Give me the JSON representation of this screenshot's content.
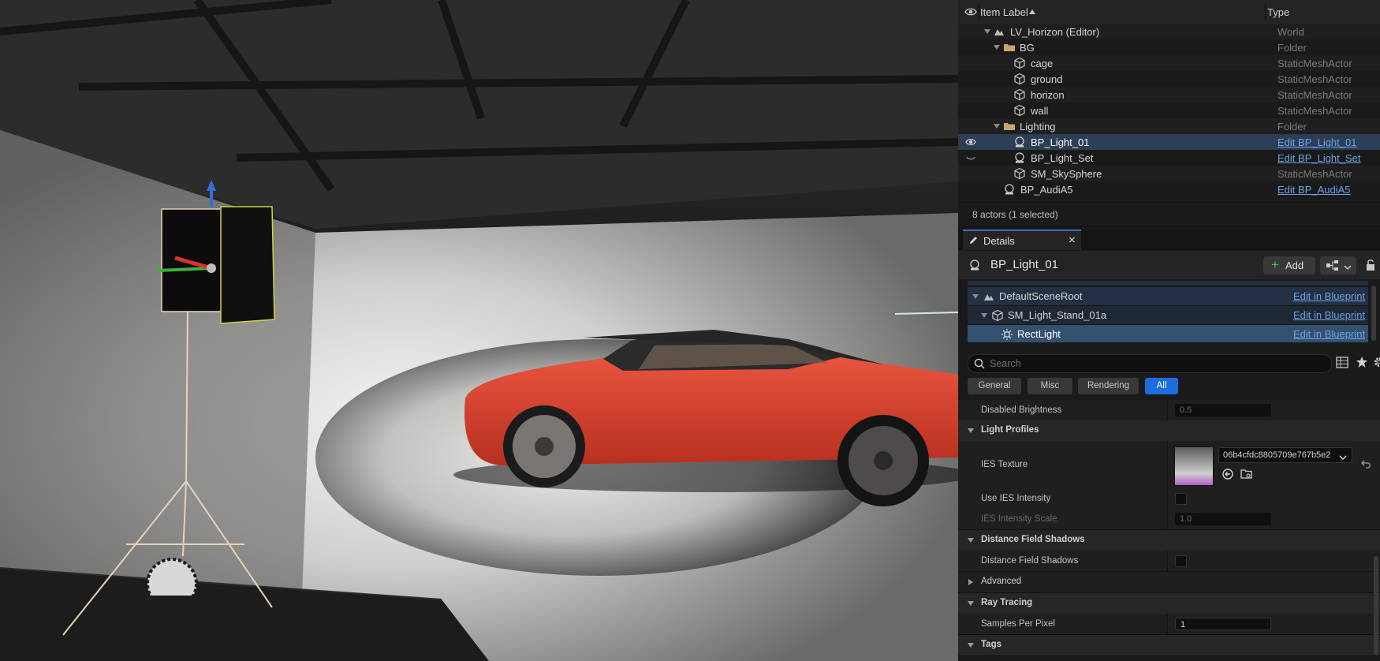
{
  "outliner": {
    "col_item_label": "Item Label",
    "col_type": "Type",
    "rows": [
      {
        "label": "LV_Horizon (Editor)",
        "type": "World"
      },
      {
        "label": "BG",
        "type": "Folder"
      },
      {
        "label": "cage",
        "type": "StaticMeshActor"
      },
      {
        "label": "ground",
        "type": "StaticMeshActor"
      },
      {
        "label": "horizon",
        "type": "StaticMeshActor"
      },
      {
        "label": "wall",
        "type": "StaticMeshActor"
      },
      {
        "label": "Lighting",
        "type": "Folder"
      },
      {
        "label": "BP_Light_01",
        "type": "Edit BP_Light_01"
      },
      {
        "label": "BP_Light_Set",
        "type": "Edit BP_Light_Set"
      },
      {
        "label": "SM_SkySphere",
        "type": "StaticMeshActor"
      },
      {
        "label": "BP_AudiA5",
        "type": "Edit BP_AudiA5"
      }
    ],
    "status": "8 actors (1 selected)"
  },
  "details": {
    "tab_label": "Details",
    "close_glyph": "×",
    "object_name": "BP_Light_01",
    "add_label": "Add",
    "components": [
      {
        "label": "DefaultSceneRoot",
        "link": "Edit in Blueprint"
      },
      {
        "label": "SM_Light_Stand_01a",
        "link": "Edit in Blueprint"
      },
      {
        "label": "RectLight",
        "link": "Edit in Blueprint"
      }
    ],
    "search_placeholder": "Search",
    "filters": [
      "General",
      "Misc",
      "Rendering",
      "All"
    ],
    "properties": {
      "disabled_brightness_label": "Disabled Brightness",
      "disabled_brightness_value": "0.5",
      "light_profiles": "Light Profiles",
      "ies_texture_label": "IES Texture",
      "ies_texture_value": "06b4cfdc8805709e767b5e2",
      "use_ies_intensity_label": "Use IES Intensity",
      "ies_intensity_scale_label": "IES Intensity Scale",
      "ies_intensity_scale_value": "1.0",
      "distance_field_shadows_cat": "Distance Field Shadows",
      "distance_field_shadows_label": "Distance Field Shadows",
      "advanced_cat": "Advanced",
      "ray_tracing_cat": "Ray Tracing",
      "samples_per_pixel_label": "Samples Per Pixel",
      "samples_per_pixel_value": "1",
      "tags_cat": "Tags"
    }
  },
  "colors": {
    "accent": "#1d6ddf",
    "link": "#6ea1e6",
    "selection": "#2c3e55",
    "car": "#d8412e"
  }
}
